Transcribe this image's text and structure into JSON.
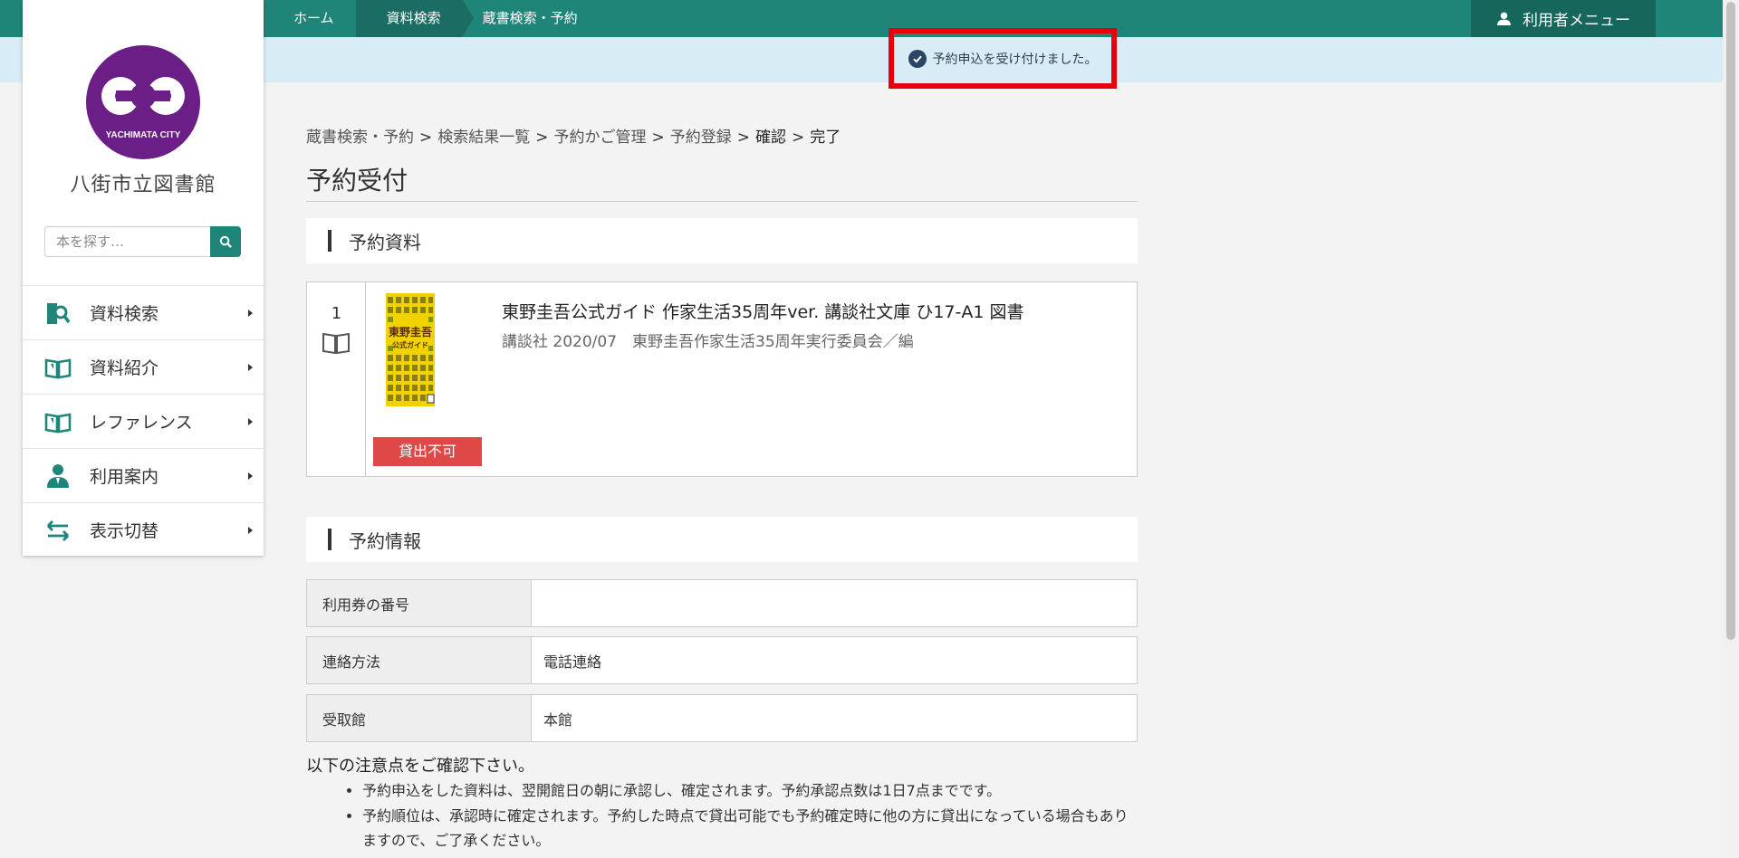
{
  "topnav": {
    "items": [
      {
        "label": "ホーム"
      },
      {
        "label": "資料検索"
      },
      {
        "label": "蔵書検索・予約"
      }
    ],
    "user_menu": "利用者メニュー"
  },
  "notice": {
    "message": "予約申込を受け付けました。"
  },
  "sidebar": {
    "library_name": "八街市立図書館",
    "logo_text": "YACHIMATA CITY",
    "search_placeholder": "本を探す…",
    "menu": [
      {
        "label": "資料検索",
        "icon": "search-book-icon"
      },
      {
        "label": "資料紹介",
        "icon": "open-book-icon"
      },
      {
        "label": "レファレンス",
        "icon": "open-book-icon"
      },
      {
        "label": "利用案内",
        "icon": "person-icon"
      },
      {
        "label": "表示切替",
        "icon": "swap-arrows-icon"
      }
    ]
  },
  "breadcrumb": {
    "items": [
      "蔵書検索・予約",
      "検索結果一覧",
      "予約かご管理",
      "予約登録",
      "確認",
      "完了"
    ],
    "separator": ">"
  },
  "page": {
    "title": "予約受付"
  },
  "reserved_section": {
    "heading": "予約資料"
  },
  "item": {
    "number": "1",
    "title": "東野圭吾公式ガイド 作家生活35周年ver. 講談社文庫 ひ17-A1 図書",
    "meta": "講談社 2020/07　東野圭吾作家生活35周年実行委員会／編",
    "status": "貸出不可",
    "cover_title": "東野圭吾",
    "cover_subtitle": "公式ガイド"
  },
  "info_section": {
    "heading": "予約情報",
    "rows": [
      {
        "label": "利用券の番号",
        "value": ""
      },
      {
        "label": "連絡方法",
        "value": "電話連絡"
      },
      {
        "label": "受取館",
        "value": "本館"
      }
    ]
  },
  "notes": {
    "heading": "以下の注意点をご確認下さい。",
    "items": [
      "予約申込をした資料は、翌開館日の朝に承認し、確定されます。予約承認点数は1日7点までです。",
      "予約順位は、承認時に確定されます。予約した時点で貸出可能でも予約確定時に他の方に貸出になっている場合もありますので、ご了承ください。"
    ]
  },
  "colors": {
    "brand": "#208579",
    "brand_dark": "#1b6d63",
    "logo": "#6a1e86",
    "badge": "#e04848",
    "highlight": "#e8000b"
  }
}
